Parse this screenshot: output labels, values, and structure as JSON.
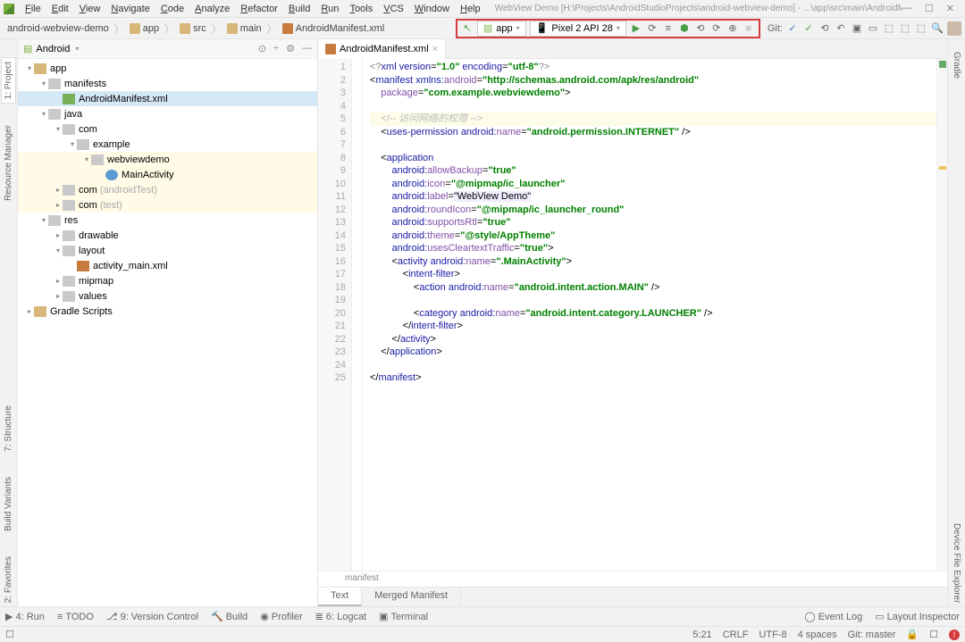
{
  "menu": [
    "File",
    "Edit",
    "View",
    "Navigate",
    "Code",
    "Analyze",
    "Refactor",
    "Build",
    "Run",
    "Tools",
    "VCS",
    "Window",
    "Help"
  ],
  "window_title": "WebView Demo [H:\\Projects\\AndroidStudioProjects\\android-webview-demo] - ...\\app\\src\\main\\AndroidManifest.xml [app]",
  "breadcrumb": [
    {
      "label": "android-webview-demo",
      "ic": ""
    },
    {
      "label": "app",
      "ic": "ic-folder"
    },
    {
      "label": "src",
      "ic": "ic-folder"
    },
    {
      "label": "main",
      "ic": "ic-folder"
    },
    {
      "label": "AndroidManifest.xml",
      "ic": "ic-xml"
    }
  ],
  "run_config": "app",
  "device": "Pixel 2 API 28",
  "git_label": "Git:",
  "project_header": "Android",
  "tree": [
    {
      "d": 0,
      "tw": "▾",
      "ic": "pkg",
      "label": "app",
      "sel": false
    },
    {
      "d": 1,
      "tw": "▾",
      "ic": "fold",
      "label": "manifests",
      "sel": false
    },
    {
      "d": 2,
      "tw": "",
      "ic": "man",
      "label": "AndroidManifest.xml",
      "sel": true
    },
    {
      "d": 1,
      "tw": "▾",
      "ic": "fold",
      "label": "java",
      "sel": false
    },
    {
      "d": 2,
      "tw": "▾",
      "ic": "fold",
      "label": "com",
      "sel": false
    },
    {
      "d": 3,
      "tw": "▾",
      "ic": "fold",
      "label": "example",
      "sel": false
    },
    {
      "d": 4,
      "tw": "▾",
      "ic": "fold",
      "label": "webviewdemo",
      "sel": false,
      "hl": true
    },
    {
      "d": 5,
      "tw": "",
      "ic": "cls",
      "label": "MainActivity",
      "sel": false,
      "hl": true
    },
    {
      "d": 2,
      "tw": "▸",
      "ic": "fold",
      "label": "com",
      "gray": "(androidTest)",
      "sel": false,
      "hl": true
    },
    {
      "d": 2,
      "tw": "▸",
      "ic": "fold",
      "label": "com",
      "gray": "(test)",
      "sel": false,
      "hl": true
    },
    {
      "d": 1,
      "tw": "▾",
      "ic": "fold",
      "label": "res",
      "sel": false
    },
    {
      "d": 2,
      "tw": "▸",
      "ic": "fold",
      "label": "drawable",
      "sel": false
    },
    {
      "d": 2,
      "tw": "▾",
      "ic": "fold",
      "label": "layout",
      "sel": false
    },
    {
      "d": 3,
      "tw": "",
      "ic": "xml",
      "label": "activity_main.xml",
      "sel": false
    },
    {
      "d": 2,
      "tw": "▸",
      "ic": "fold",
      "label": "mipmap",
      "sel": false
    },
    {
      "d": 2,
      "tw": "▸",
      "ic": "fold",
      "label": "values",
      "sel": false
    },
    {
      "d": 0,
      "tw": "▸",
      "ic": "pkg",
      "label": "Gradle Scripts",
      "sel": false
    }
  ],
  "editor_tab": "AndroidManifest.xml",
  "code_lines": [
    {
      "n": 1,
      "html": "<span class='c-pi'>&lt;?</span><span class='c-tag'>xml version</span>=<span class='c-str'>\"1.0\"</span> <span class='c-tag'>encoding</span>=<span class='c-str'>\"utf-8\"</span><span class='c-pi'>?&gt;</span>"
    },
    {
      "n": 2,
      "html": "&lt;<span class='c-tag'>manifest</span> <span class='c-ns'>xmlns:</span><span class='c-attr'>android</span>=<span class='c-str'>\"http://schemas.android.com/apk/res/android\"</span>"
    },
    {
      "n": 3,
      "html": "    <span class='c-attr'>package</span>=<span class='c-str'>\"com.example.webviewdemo\"</span>&gt;"
    },
    {
      "n": 4,
      "html": ""
    },
    {
      "n": 5,
      "html": "    <span class='c-cmt'>&lt;!-- 访问网络的权限 --&gt;</span>",
      "hl": true
    },
    {
      "n": 6,
      "html": "    &lt;<span class='c-tag'>uses-permission</span> <span class='c-ns'>android:</span><span class='c-attr'>name</span>=<span class='c-str'>\"android.permission.INTERNET\"</span> /&gt;"
    },
    {
      "n": 7,
      "html": ""
    },
    {
      "n": 8,
      "html": "    &lt;<span class='c-tag'>application</span>"
    },
    {
      "n": 9,
      "html": "        <span class='c-ns'>android:</span><span class='c-attr'>allowBackup</span>=<span class='c-str'>\"true\"</span>"
    },
    {
      "n": 10,
      "html": "        <span class='c-ns'>android:</span><span class='c-attr'>icon</span>=<span class='c-str'>\"@mipmap/ic_launcher\"</span>"
    },
    {
      "n": 11,
      "html": "        <span class='c-ns'>android:</span><span class='c-attr'>label</span>=<span style='background:#eef'>\"WebView Demo\"</span>"
    },
    {
      "n": 12,
      "html": "        <span class='c-ns'>android:</span><span class='c-attr'>roundIcon</span>=<span class='c-str'>\"@mipmap/ic_launcher_round\"</span>"
    },
    {
      "n": 13,
      "html": "        <span class='c-ns'>android:</span><span class='c-attr'>supportsRtl</span>=<span class='c-str'>\"true\"</span>"
    },
    {
      "n": 14,
      "html": "        <span class='c-ns'>android:</span><span class='c-attr'>theme</span>=<span class='c-str'>\"@style/AppTheme\"</span>"
    },
    {
      "n": 15,
      "html": "        <span class='c-ns'>android:</span><span class='c-attr'>usesCleartextTraffic</span>=<span class='c-str'>\"true\"</span>&gt;"
    },
    {
      "n": 16,
      "html": "        &lt;<span class='c-tag'>activity</span> <span class='c-ns'>android:</span><span class='c-attr'>name</span>=<span class='c-str'>\".MainActivity\"</span>&gt;"
    },
    {
      "n": 17,
      "html": "            &lt;<span class='c-tag'>intent-filter</span>&gt;"
    },
    {
      "n": 18,
      "html": "                &lt;<span class='c-tag'>action</span> <span class='c-ns'>android:</span><span class='c-attr'>name</span>=<span class='c-str'>\"android.intent.action.MAIN\"</span> /&gt;"
    },
    {
      "n": 19,
      "html": ""
    },
    {
      "n": 20,
      "html": "                &lt;<span class='c-tag'>category</span> <span class='c-ns'>android:</span><span class='c-attr'>name</span>=<span class='c-str'>\"android.intent.category.LAUNCHER\"</span> /&gt;"
    },
    {
      "n": 21,
      "html": "            &lt;/<span class='c-tag'>intent-filter</span>&gt;"
    },
    {
      "n": 22,
      "html": "        &lt;/<span class='c-tag'>activity</span>&gt;"
    },
    {
      "n": 23,
      "html": "    &lt;/<span class='c-tag'>application</span>&gt;"
    },
    {
      "n": 24,
      "html": ""
    },
    {
      "n": 25,
      "html": "&lt;/<span class='c-tag'>manifest</span>&gt;"
    }
  ],
  "bottom_breadcrumb": "manifest",
  "bottom_tabs": [
    "Text",
    "Merged Manifest"
  ],
  "tool_windows_left": [
    {
      "ic": "▶",
      "label": "4: Run"
    },
    {
      "ic": "≡",
      "label": "TODO"
    },
    {
      "ic": "⎇",
      "label": "9: Version Control"
    },
    {
      "ic": "🔨",
      "label": "Build"
    },
    {
      "ic": "◉",
      "label": "Profiler"
    },
    {
      "ic": "≣",
      "label": "6: Logcat"
    },
    {
      "ic": "▣",
      "label": "Terminal"
    }
  ],
  "tool_windows_right": [
    {
      "ic": "◯",
      "label": "Event Log"
    },
    {
      "ic": "▭",
      "label": "Layout Inspector"
    }
  ],
  "status": {
    "pos": "5:21",
    "lf": "CRLF",
    "enc": "UTF-8",
    "indent": "4 spaces",
    "git": "Git: master"
  },
  "left_vtabs": [
    "1: Project",
    "Resource Manager"
  ],
  "left_vtabs2": [
    "7: Structure",
    "Build Variants",
    "2: Favorites"
  ],
  "right_vtabs": [
    "Gradle",
    "Device File Explorer"
  ]
}
